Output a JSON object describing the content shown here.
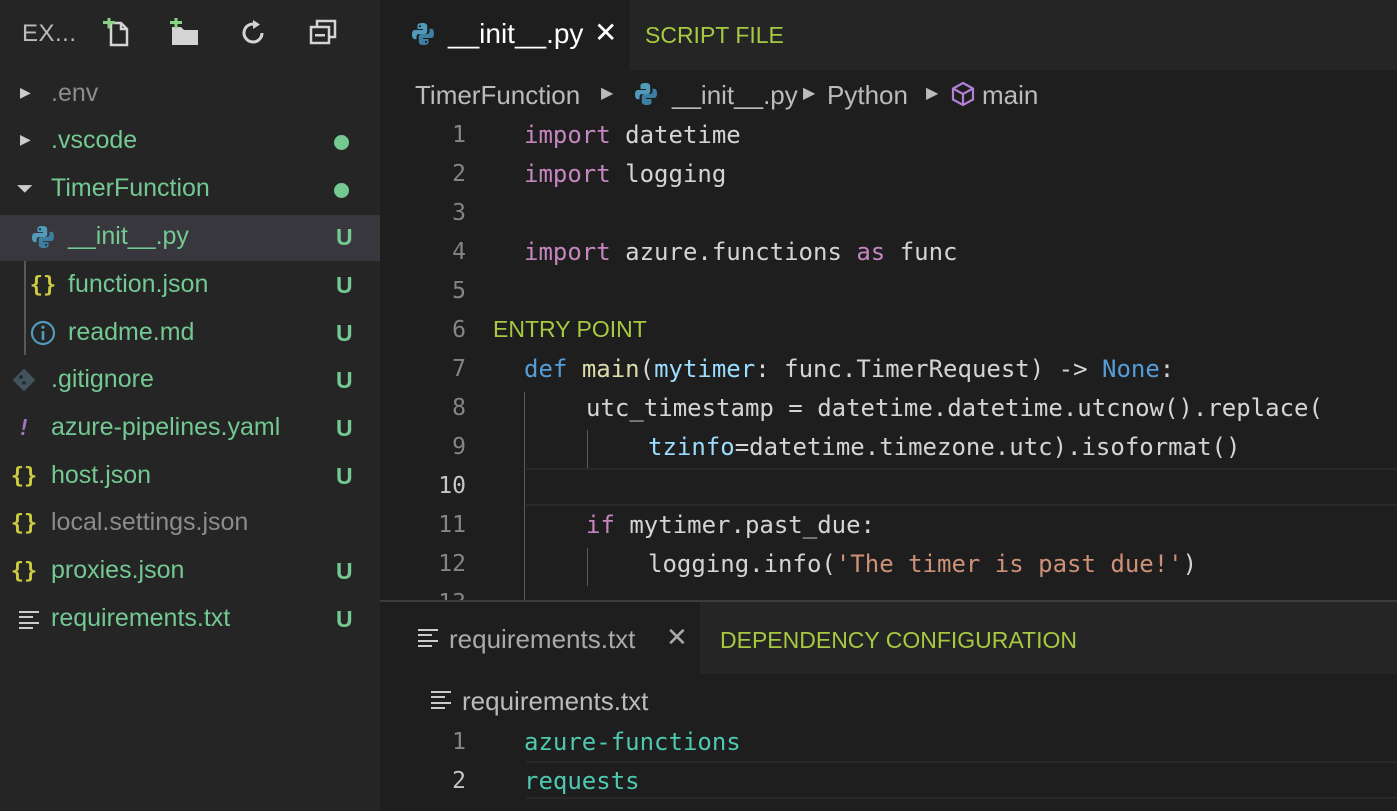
{
  "explorer": {
    "title": "EX...",
    "actions": [
      {
        "name": "new-file-icon"
      },
      {
        "name": "new-folder-icon"
      },
      {
        "name": "refresh-icon"
      },
      {
        "name": "collapse-all-icon"
      }
    ],
    "items": [
      {
        "label": ".env",
        "kind": "folder",
        "state": "collapsed",
        "status": "",
        "color": "#8c8c8c"
      },
      {
        "label": ".vscode",
        "kind": "folder",
        "state": "collapsed",
        "status": "dot",
        "color": "#73c991"
      },
      {
        "label": "TimerFunction",
        "kind": "folder",
        "state": "expanded",
        "status": "dot",
        "color": "#73c991"
      },
      {
        "label": "__init__.py",
        "kind": "python",
        "status": "U",
        "selected": true,
        "indent": 1
      },
      {
        "label": "function.json",
        "kind": "json",
        "status": "U",
        "indent": 1
      },
      {
        "label": "readme.md",
        "kind": "info",
        "status": "U",
        "indent": 1
      },
      {
        "label": ".gitignore",
        "kind": "git",
        "status": "U"
      },
      {
        "label": "azure-pipelines.yaml",
        "kind": "yaml",
        "status": "U"
      },
      {
        "label": "host.json",
        "kind": "json",
        "status": "U"
      },
      {
        "label": "local.settings.json",
        "kind": "json",
        "status": "",
        "color": "#8c8c8c"
      },
      {
        "label": "proxies.json",
        "kind": "json",
        "status": "U"
      },
      {
        "label": "requirements.txt",
        "kind": "text",
        "status": "U"
      }
    ]
  },
  "editor_top": {
    "tab_label": "__init__.py",
    "tab_close": "✕",
    "annotation": "SCRIPT FILE",
    "breadcrumb": [
      "TimerFunction",
      "__init__.py",
      "Python",
      "main"
    ],
    "entry_annotation": "ENTRY POINT",
    "current_line": 10,
    "lines": [
      {
        "n": "1",
        "code": "import datetime"
      },
      {
        "n": "2",
        "code": "import logging"
      },
      {
        "n": "3",
        "code": ""
      },
      {
        "n": "4",
        "code": "import azure.functions as func"
      },
      {
        "n": "5",
        "code": ""
      },
      {
        "n": "6",
        "code": "def main(mytimer: func.TimerRequest) -> None:"
      },
      {
        "n": "7",
        "code": "    utc_timestamp = datetime.datetime.utcnow().replace("
      },
      {
        "n": "8",
        "code": "        tzinfo=datetime.timezone.utc).isoformat()"
      },
      {
        "n": "9",
        "code": ""
      },
      {
        "n": "10",
        "code": "    if mytimer.past_due:"
      },
      {
        "n": "11",
        "code": "        logging.info('The timer is past due!')"
      },
      {
        "n": "12",
        "code": ""
      }
    ]
  },
  "editor_bottom": {
    "tab_label": "requirements.txt",
    "tab_close": "✕",
    "annotation": "DEPENDENCY CONFIGURATION",
    "breadcrumb": "requirements.txt",
    "lines": [
      {
        "n": "1",
        "code": "azure-functions"
      },
      {
        "n": "2",
        "code": "requests"
      }
    ]
  },
  "colors": {
    "status_green": "#73c991",
    "annotation": "#a7c940",
    "json_icon": "#cbcb41",
    "python_icon": "#519aba",
    "yaml_icon": "#a074c4"
  }
}
